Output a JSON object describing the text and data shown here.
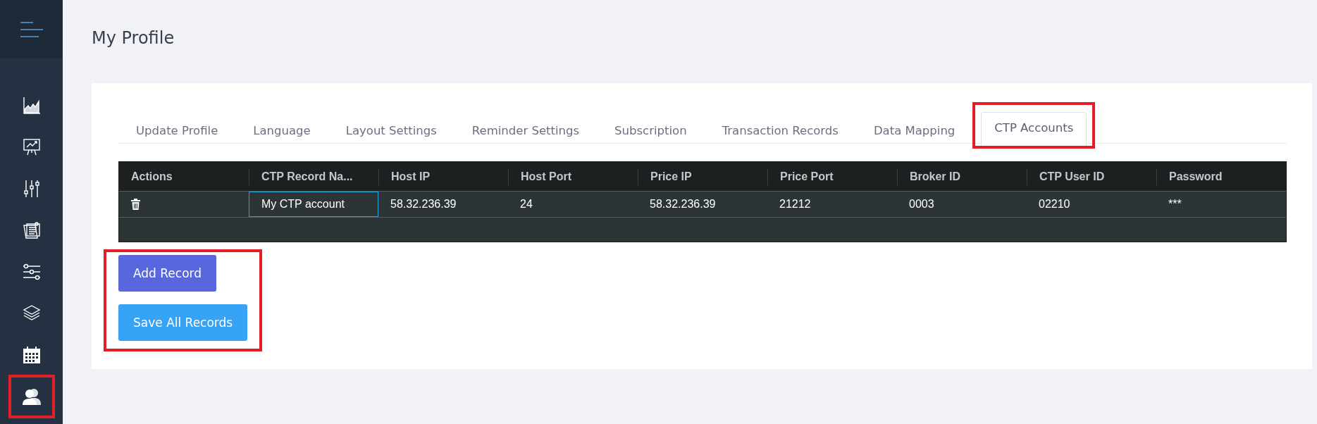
{
  "sidebar": {
    "items": [
      {
        "highlighted": false
      },
      {
        "highlighted": false
      },
      {
        "highlighted": false
      },
      {
        "highlighted": false
      },
      {
        "highlighted": false
      },
      {
        "highlighted": false
      },
      {
        "highlighted": false
      },
      {
        "highlighted": true
      }
    ]
  },
  "page": {
    "title": "My Profile"
  },
  "tabs": [
    {
      "label": "Update Profile",
      "selected": false,
      "highlighted": false
    },
    {
      "label": "Language",
      "selected": false,
      "highlighted": false
    },
    {
      "label": "Layout Settings",
      "selected": false,
      "highlighted": false
    },
    {
      "label": "Reminder Settings",
      "selected": false,
      "highlighted": false
    },
    {
      "label": "Subscription",
      "selected": false,
      "highlighted": false
    },
    {
      "label": "Transaction Records",
      "selected": false,
      "highlighted": false
    },
    {
      "label": "Data Mapping",
      "selected": false,
      "highlighted": false
    },
    {
      "label": "CTP Accounts",
      "selected": true,
      "highlighted": true
    }
  ],
  "table": {
    "columns": [
      "Actions",
      "CTP Record Na...",
      "Host IP",
      "Host Port",
      "Price IP",
      "Price Port",
      "Broker ID",
      "CTP User ID",
      "Password"
    ],
    "rows": [
      {
        "cells": [
          {
            "text": "",
            "focused": false
          },
          {
            "text": "My CTP account",
            "focused": true
          },
          {
            "text": "58.32.236.39",
            "focused": false
          },
          {
            "text": "24",
            "focused": false
          },
          {
            "text": "58.32.236.39",
            "focused": false
          },
          {
            "text": "21212",
            "focused": false
          },
          {
            "text": "0003",
            "focused": false
          },
          {
            "text": "02210",
            "focused": false
          },
          {
            "text": "***",
            "focused": false
          }
        ]
      }
    ]
  },
  "buttons": [
    {
      "label": "Add Record",
      "kind": "primary"
    },
    {
      "label": "Save All Records",
      "kind": "info"
    }
  ],
  "buttons_highlighted": true
}
